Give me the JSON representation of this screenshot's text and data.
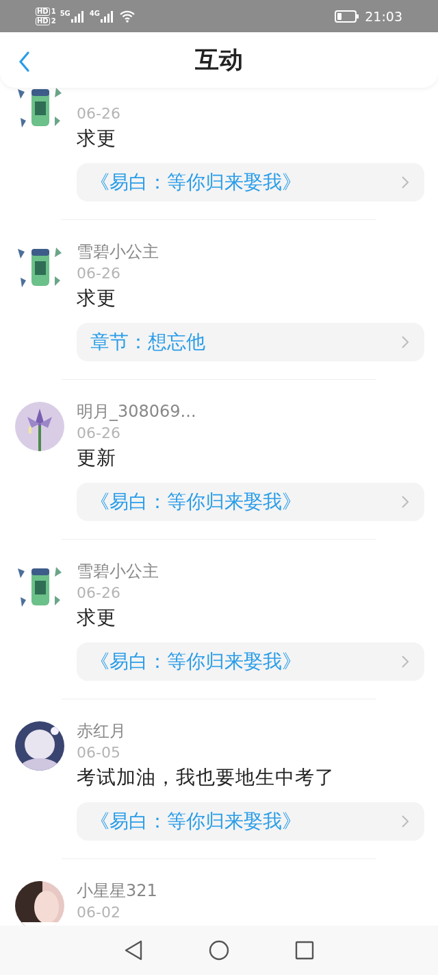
{
  "status_bar": {
    "sims": [
      {
        "badge": "HD",
        "slot": "1"
      },
      {
        "badge": "HD",
        "slot": "2"
      }
    ],
    "networks": [
      "5G",
      "4G"
    ],
    "time": "21:03"
  },
  "header": {
    "title": "互动"
  },
  "comments": [
    {
      "date": "06-26",
      "text": "求更",
      "link": "《易白：等你归来娶我》"
    },
    {
      "user": "雪碧小公主",
      "date": "06-26",
      "text": "求更",
      "link": "章节：想忘他"
    },
    {
      "user": "明月_308069...",
      "date": "06-26",
      "text": "更新",
      "link": "《易白：等你归来娶我》"
    },
    {
      "user": "雪碧小公主",
      "date": "06-26",
      "text": "求更",
      "link": "《易白：等你归来娶我》"
    },
    {
      "user": "赤红月",
      "date": "06-05",
      "text": "考试加油，我也要地生中考了",
      "link": "《易白：等你归来娶我》"
    },
    {
      "user": "小星星321",
      "date": "06-02"
    }
  ]
}
